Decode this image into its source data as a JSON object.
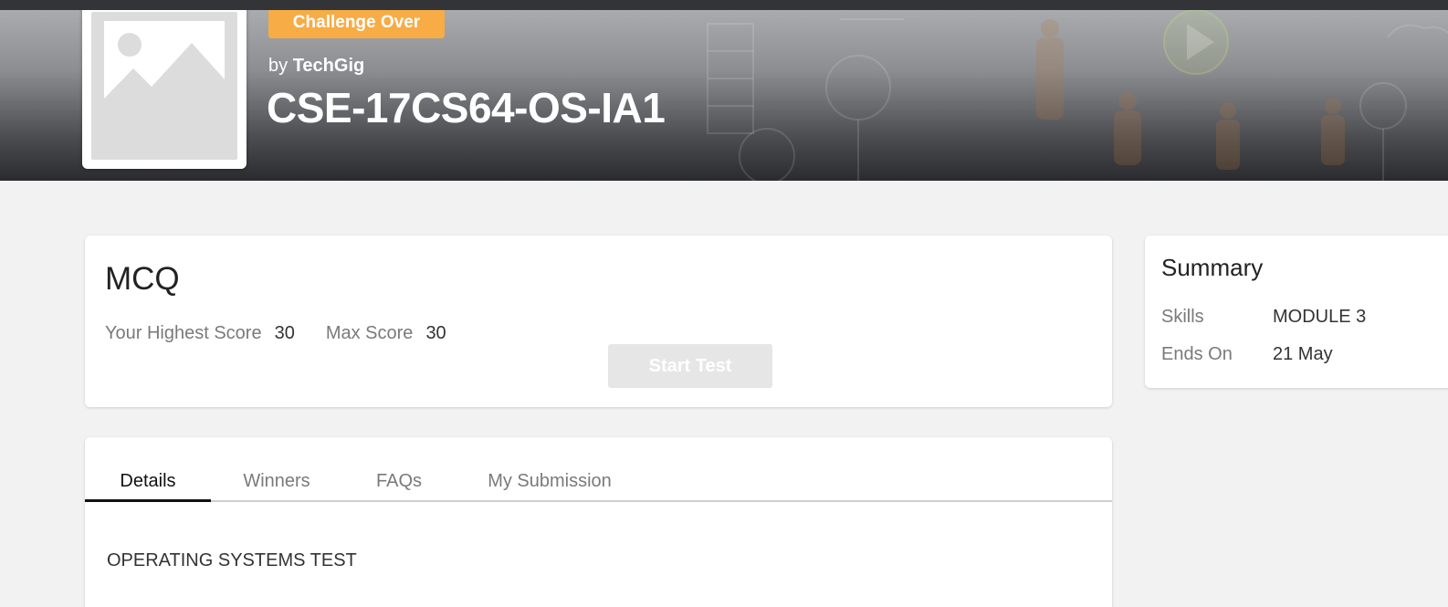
{
  "banner": {
    "status_badge": "Challenge Over",
    "by_prefix": "by",
    "organizer": "TechGig",
    "challenge_title": "CSE-17CS64-OS-IA1"
  },
  "test_card": {
    "title": "MCQ",
    "highest_score_label": "Your Highest Score",
    "highest_score_value": "30",
    "max_score_label": "Max Score",
    "max_score_value": "30",
    "start_button": "Start Test"
  },
  "summary": {
    "title": "Summary",
    "rows": [
      {
        "label": "Skills",
        "value": "MODULE 3"
      },
      {
        "label": "Ends On",
        "value": "21 May"
      }
    ]
  },
  "tabs": [
    {
      "label": "Details",
      "active": true
    },
    {
      "label": "Winners",
      "active": false
    },
    {
      "label": "FAQs",
      "active": false
    },
    {
      "label": "My Submission",
      "active": false
    }
  ],
  "details": {
    "description": "OPERATING SYSTEMS TEST"
  },
  "colors": {
    "badge": "#f7ac46",
    "page_bg": "#f2f2f2",
    "topbar": "#333438"
  },
  "icons": {
    "logo_placeholder": "image-placeholder-icon"
  }
}
